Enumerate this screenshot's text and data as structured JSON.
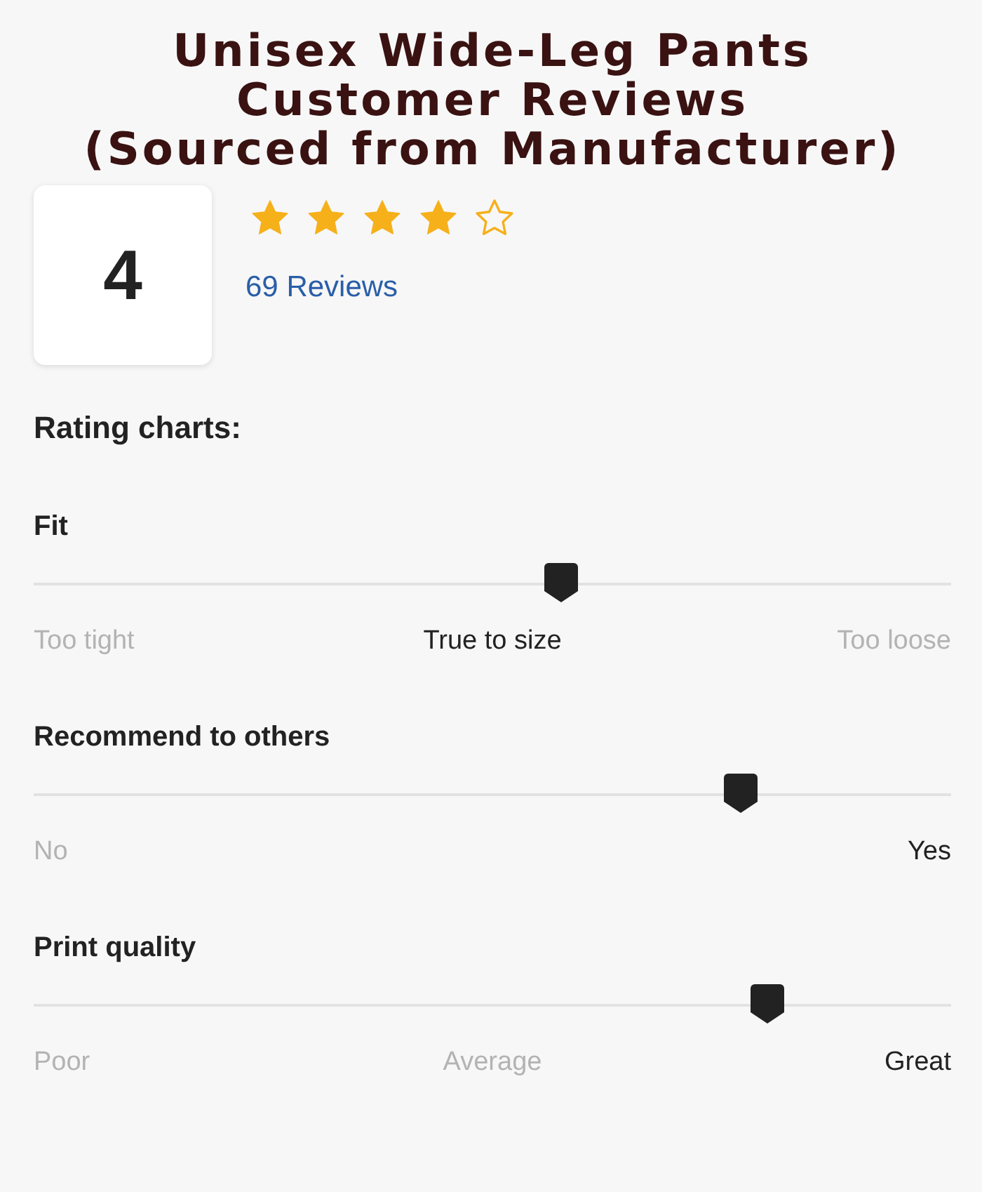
{
  "title_lines": [
    "Unisex Wide-Leg Pants",
    "Customer Reviews",
    "(Sourced from Manufacturer)"
  ],
  "summary": {
    "score": "4",
    "stars": 4,
    "reviews_link": "69 Reviews"
  },
  "charts_heading": "Rating charts:",
  "rating_charts": [
    {
      "name": "Fit",
      "level": 0.575,
      "labels": [
        {
          "text": "Too tight",
          "selected": false
        },
        {
          "text": "True to size",
          "selected": true
        },
        {
          "text": "Too loose",
          "selected": false
        }
      ]
    },
    {
      "name": "Recommend to others",
      "level": 0.77,
      "labels": [
        {
          "text": "No",
          "selected": false
        },
        {
          "text": "Yes",
          "selected": true
        }
      ]
    },
    {
      "name": "Print quality",
      "level": 0.8,
      "labels": [
        {
          "text": "Poor",
          "selected": false
        },
        {
          "text": "Average",
          "selected": false
        },
        {
          "text": "Great",
          "selected": true
        }
      ]
    }
  ]
}
